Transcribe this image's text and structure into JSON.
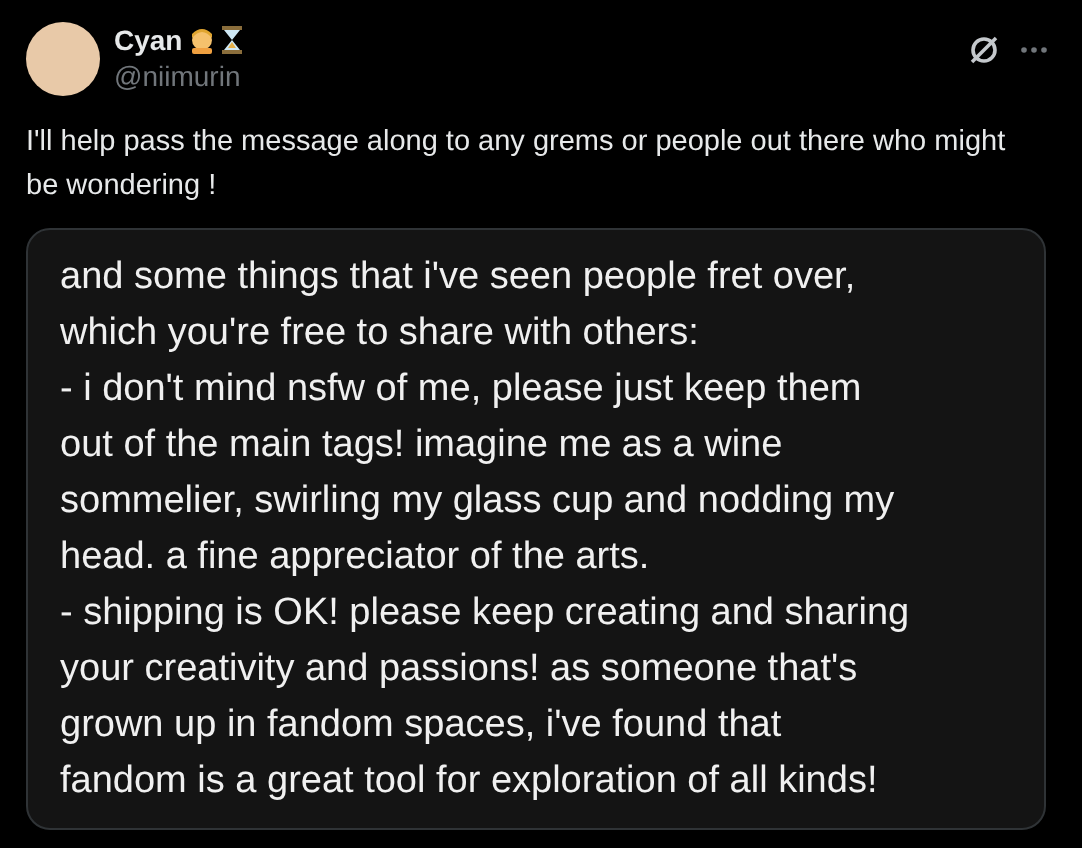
{
  "post": {
    "author_name": "Cyan",
    "handle": "@niimurin",
    "text": "I'll help pass the message along to any grems or people out there who might be wondering !"
  },
  "attached_image": {
    "lines": [
      "and some things that i've seen people fret over,",
      "which you're free to share with others:",
      "- i don't mind nsfw of me, please just keep them",
      "out of the main tags! imagine me as a wine",
      "sommelier, swirling my glass cup and nodding my",
      "head. a fine appreciator of the arts.",
      "- shipping is OK! please keep creating and sharing",
      "your creativity and passions! as someone that's",
      "grown up in fandom spaces, i've found that",
      "fandom is a great tool for exploration of all kinds!"
    ]
  }
}
